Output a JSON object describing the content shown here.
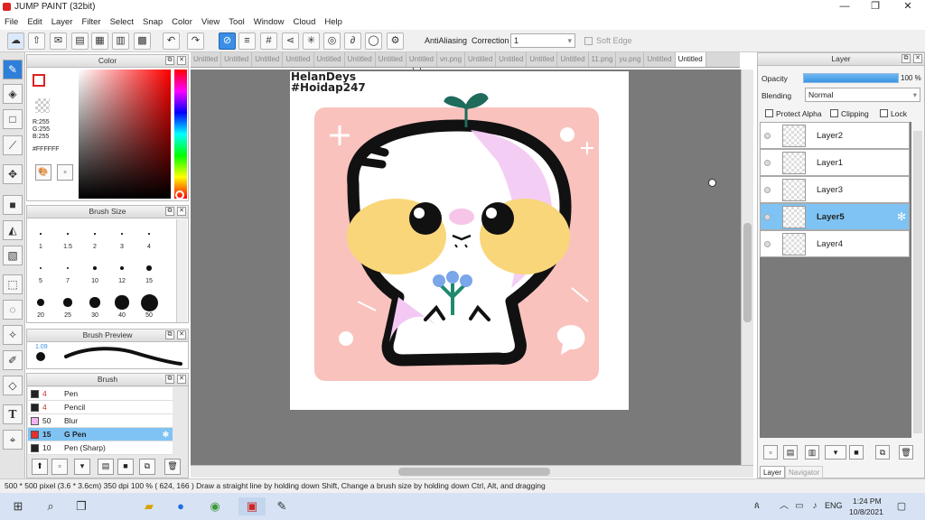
{
  "window": {
    "title": "JUMP PAINT (32bit)",
    "minimize": "—",
    "maximize": "❐",
    "close": "✕"
  },
  "menu": [
    "File",
    "Edit",
    "Layer",
    "Filter",
    "Select",
    "Snap",
    "Color",
    "View",
    "Tool",
    "Window",
    "Cloud",
    "Help"
  ],
  "toolbar": {
    "antialiasing_label": "AntiAliasing",
    "correction_label": "Correction",
    "correction_value": "1",
    "softedge_label": "Soft Edge"
  },
  "color_panel": {
    "title": "Color",
    "r": "R:255",
    "g": "G:255",
    "b": "B:255",
    "hex": "#FFFFFF"
  },
  "brush_size_panel": {
    "title": "Brush Size",
    "sizes": [
      "1",
      "1.5",
      "2",
      "3",
      "4",
      "5",
      "7",
      "10",
      "12",
      "15",
      "20",
      "25",
      "30",
      "40",
      "50"
    ]
  },
  "brush_preview": {
    "title": "Brush Preview",
    "size_label": "1.09"
  },
  "brush_panel": {
    "title": "Brush",
    "items": [
      {
        "size": "4",
        "name": "Pen",
        "color": "#222222"
      },
      {
        "size": "4",
        "name": "Pencil",
        "color": "#222222"
      },
      {
        "size": "50",
        "name": "Blur",
        "color": "#f4b4f4"
      },
      {
        "size": "15",
        "name": "G Pen",
        "color": "#e03030"
      },
      {
        "size": "10",
        "name": "Pen (Sharp)",
        "color": "#222222"
      }
    ]
  },
  "tabs": [
    "Untitled",
    "Untitled",
    "Untitled",
    "Untitled",
    "Untitled",
    "Untitled",
    "Untitled",
    "Untitled",
    "vn.png",
    "Untitled",
    "Untitled",
    "Untitled",
    "Untitled",
    "11.png",
    "yu.png",
    "Untitled",
    "Untitled"
  ],
  "artwork": {
    "line1": "HelanDeys",
    "line2": "#Hoidap247"
  },
  "layer_panel": {
    "title": "Layer",
    "opacity_label": "Opacity",
    "opacity_value": "100 %",
    "opacity": 1.0,
    "blending_label": "Blending",
    "blending_value": "Normal",
    "protect_alpha": "Protect Alpha",
    "clipping": "Clipping",
    "lock": "Lock",
    "layers": [
      "Layer2",
      "Layer1",
      "Layer3",
      "Layer5",
      "Layer4"
    ],
    "tab_layer": "Layer",
    "tab_navigator": "Navigator"
  },
  "status": {
    "text": "500 * 500 pixel   (3.6 * 3.6cm)   350 dpi   100 %   ( 624, 166 )   Draw a straight line by holding down Shift, Change a brush size by holding down Ctrl, Alt, and dragging"
  },
  "taskbar": {
    "lang": "ENG",
    "time": "1:24 PM",
    "date": "10/8/2021"
  }
}
